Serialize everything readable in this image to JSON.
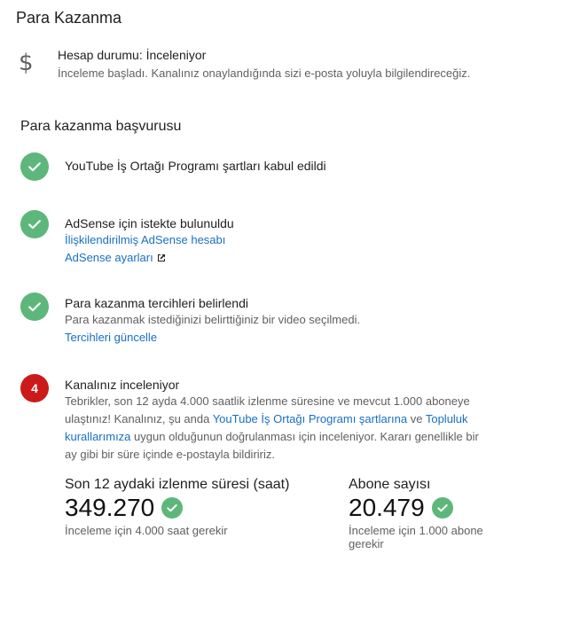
{
  "page": {
    "title": "Para Kazanma"
  },
  "account_status": {
    "icon": "dollar-icon",
    "title": "Hesap durumu: İnceleniyor",
    "description": "İnceleme başladı. Kanalınız onaylandığında sizi e-posta yoluyla bilgilendireceğiz."
  },
  "application": {
    "title": "Para kazanma başvurusu",
    "steps": [
      {
        "status": "done",
        "title": "YouTube İş Ortağı Programı şartları kabul edildi"
      },
      {
        "status": "done",
        "title": "AdSense için istekte bulunuldu",
        "links": [
          "İlişkilendirilmiş AdSense hesabı",
          "AdSense ayarları"
        ]
      },
      {
        "status": "done",
        "title": "Para kazanma tercihleri belirlendi",
        "subtitle": "Para kazanmak istediğinizi belirttiğiniz bir video seçilmedi.",
        "links": [
          "Tercihleri güncelle"
        ]
      },
      {
        "status": "pending",
        "number": "4",
        "title": "Kanalınız inceleniyor",
        "text_1": "Tebrikler, son 12 ayda 4.000 saatlik izlenme süresine ve mevcut 1.000 aboneye ulaştınız! Kanalınız, şu anda ",
        "link_1": "YouTube İş Ortağı Programı şartlarına",
        "text_2": " ve ",
        "link_2": "Topluluk kurallarımıza",
        "text_3": " uygun olduğunun doğrulanması için inceleniyor. Kararı genellikle bir ay gibi bir süre içinde e-postayla bildiririz."
      }
    ]
  },
  "metrics": [
    {
      "label": "Son 12 aydaki izlenme süresi (saat)",
      "value": "349.270",
      "note": "İnceleme için 4.000 saat gerekir"
    },
    {
      "label": "Abone sayısı",
      "value": "20.479",
      "note_line1": "İnceleme için 1.000 abone",
      "note_line2": "gerekir"
    }
  ],
  "colors": {
    "success": "#5db77a",
    "pending": "#cc1a1a",
    "link": "#1a6fc1"
  }
}
